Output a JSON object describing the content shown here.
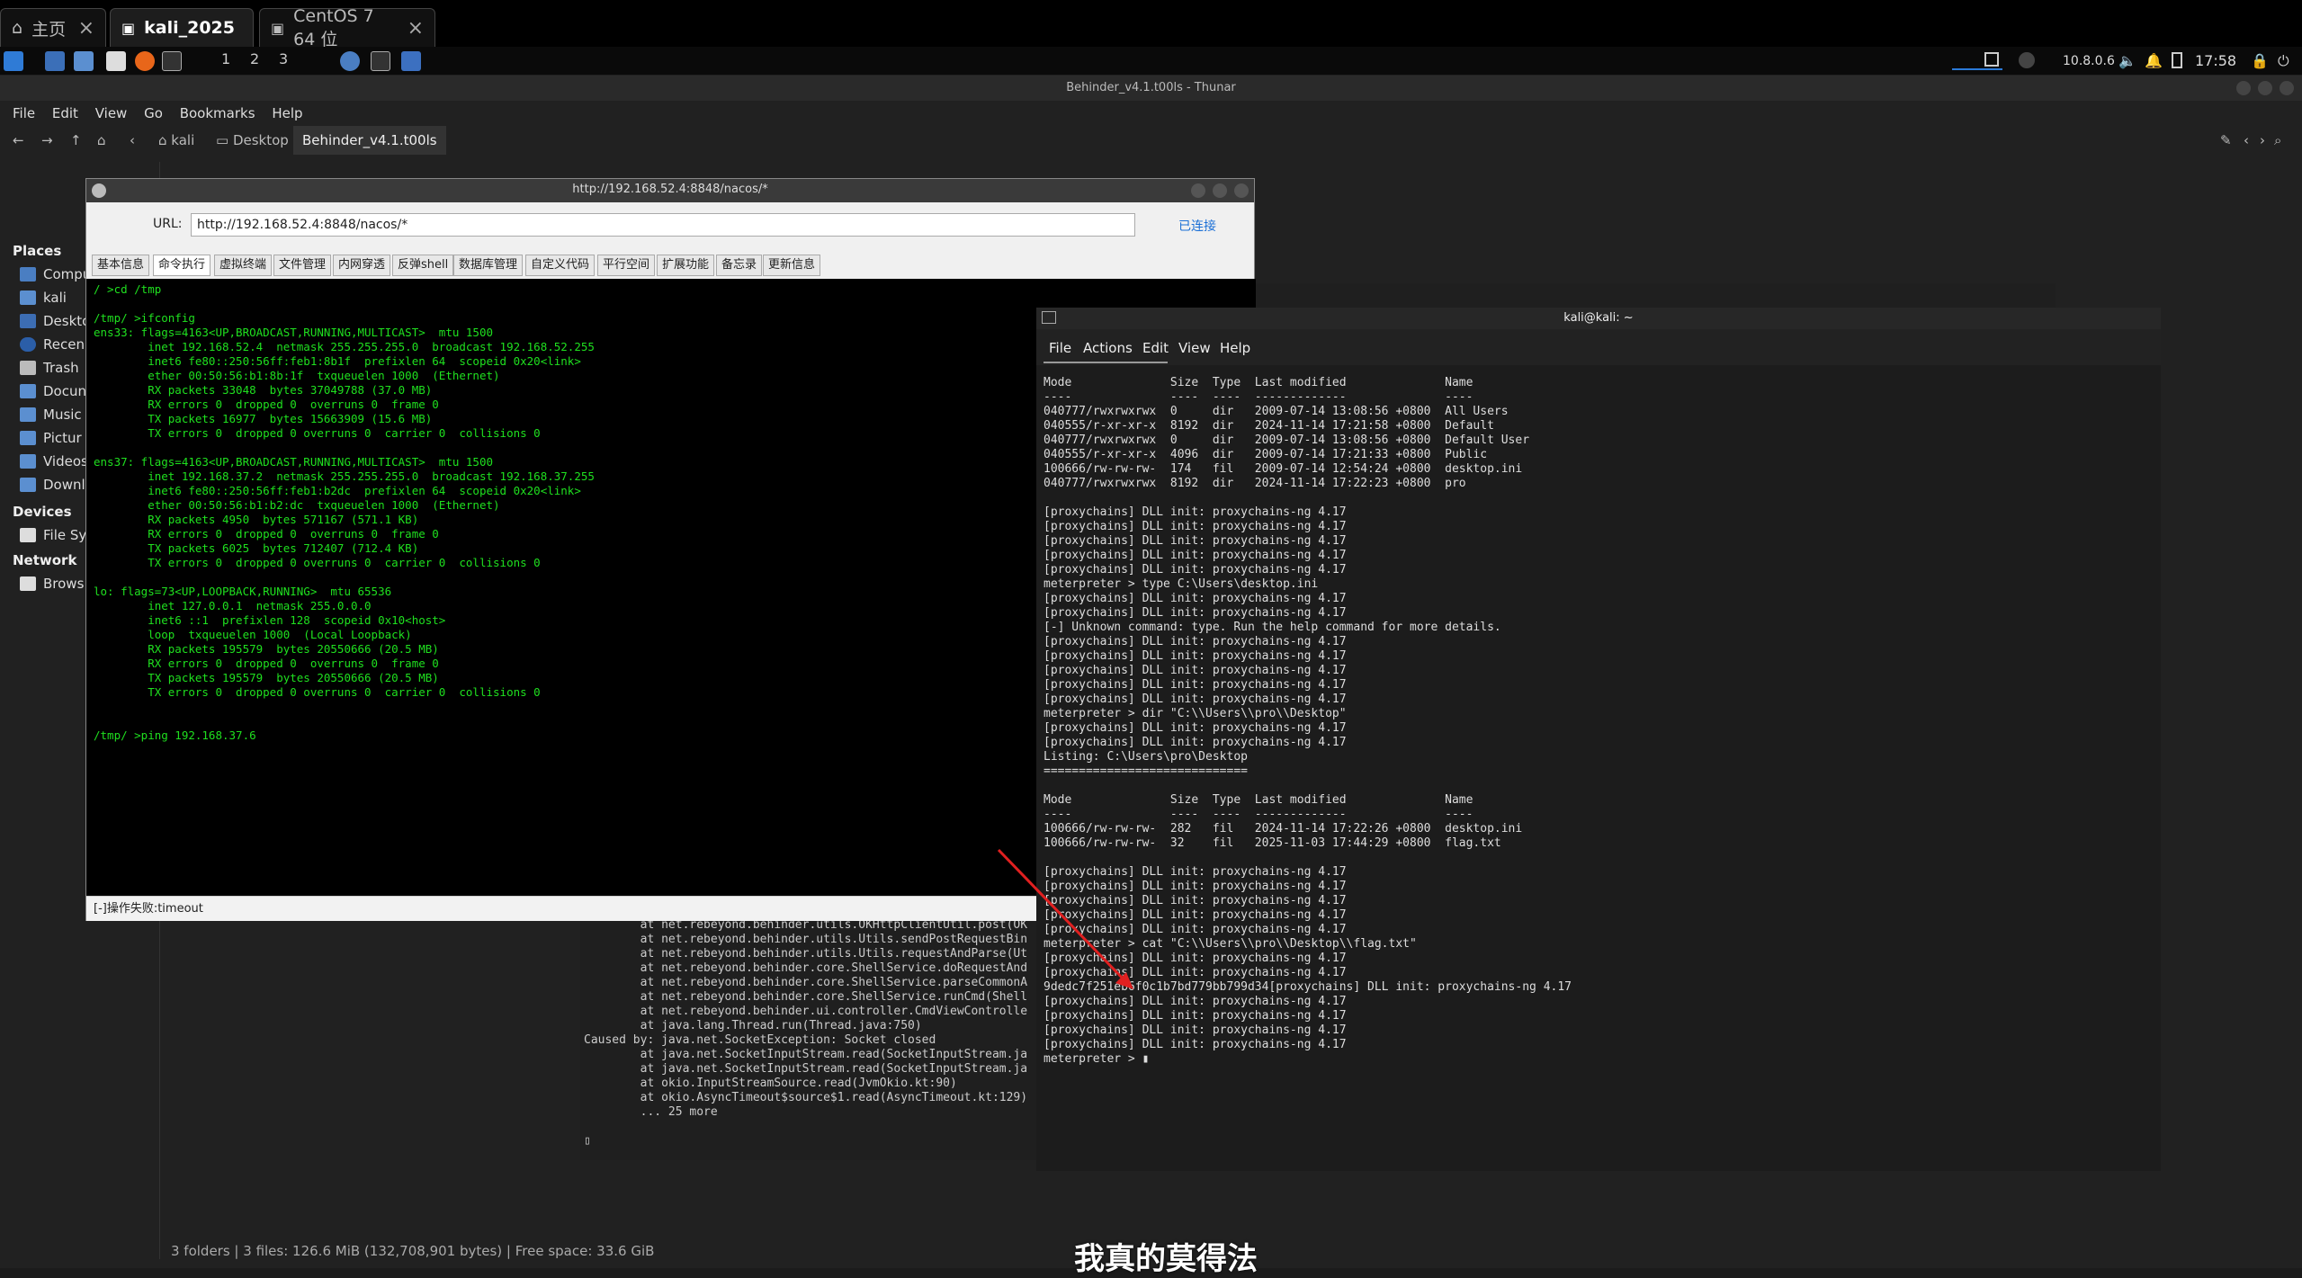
{
  "host_tabs": [
    {
      "label": "主页",
      "active": false
    },
    {
      "label": "kali_2025",
      "active": true
    },
    {
      "label": "CentOS 7 64 位",
      "active": false
    }
  ],
  "panel": {
    "workspaces": [
      "1",
      "2",
      "3"
    ],
    "ip": "10.8.0.6",
    "time": "17:58"
  },
  "thunar": {
    "title": "Behinder_v4.1.t00ls - Thunar",
    "menu": [
      "File",
      "Edit",
      "View",
      "Go",
      "Bookmarks",
      "Help"
    ],
    "breadcrumbs": [
      "kali",
      "Desktop",
      "Behinder_v4.1.t00ls"
    ],
    "sidebar": {
      "places_header": "Places",
      "places": [
        "Compu",
        "kali",
        "Deskto",
        "Recen",
        "Trash",
        "Docun",
        "Music",
        "Pictur",
        "Videos",
        "Downl"
      ],
      "devices_header": "Devices",
      "devices": [
        "File Sy"
      ],
      "network_header": "Network",
      "network": [
        "Brows"
      ]
    },
    "status": "3 folders  |  3 files: 126.6 MiB (132,708,901 bytes)  |  Free space: 33.6 GiB"
  },
  "behinder": {
    "title": "http://192.168.52.4:8848/nacos/*",
    "url_label": "URL:",
    "url": "http://192.168.52.4:8848/nacos/*",
    "connected": "已连接",
    "tabs": [
      "基本信息",
      "命令执行",
      "虚拟终端",
      "文件管理",
      "内网穿透",
      "反弹shell",
      "数据库管理",
      "自定义代码",
      "平行空间",
      "扩展功能",
      "备忘录",
      "更新信息"
    ],
    "console": "/ >cd /tmp\n\n/tmp/ >ifconfig\nens33: flags=4163<UP,BROADCAST,RUNNING,MULTICAST>  mtu 1500\n        inet 192.168.52.4  netmask 255.255.255.0  broadcast 192.168.52.255\n        inet6 fe80::250:56ff:feb1:8b1f  prefixlen 64  scopeid 0x20<link>\n        ether 00:50:56:b1:8b:1f  txqueuelen 1000  (Ethernet)\n        RX packets 33048  bytes 37049788 (37.0 MB)\n        RX errors 0  dropped 0  overruns 0  frame 0\n        TX packets 16977  bytes 15663909 (15.6 MB)\n        TX errors 0  dropped 0 overruns 0  carrier 0  collisions 0\n\nens37: flags=4163<UP,BROADCAST,RUNNING,MULTICAST>  mtu 1500\n        inet 192.168.37.2  netmask 255.255.255.0  broadcast 192.168.37.255\n        inet6 fe80::250:56ff:feb1:b2dc  prefixlen 64  scopeid 0x20<link>\n        ether 00:50:56:b1:b2:dc  txqueuelen 1000  (Ethernet)\n        RX packets 4950  bytes 571167 (571.1 KB)\n        RX errors 0  dropped 0  overruns 0  frame 0\n        TX packets 6025  bytes 712407 (712.4 KB)\n        TX errors 0  dropped 0 overruns 0  carrier 0  collisions 0\n\nlo: flags=73<UP,LOOPBACK,RUNNING>  mtu 65536\n        inet 127.0.0.1  netmask 255.0.0.0\n        inet6 ::1  prefixlen 128  scopeid 0x10<host>\n        loop  txqueuelen 1000  (Local Loopback)\n        RX packets 195579  bytes 20550666 (20.5 MB)\n        RX errors 0  dropped 0  overruns 0  frame 0\n        TX packets 195579  bytes 20550666 (20.5 MB)\n        TX errors 0  dropped 0 overruns 0  carrier 0  collisions 0\n\n\n/tmp/ >ping 192.168.37.6",
    "status": "[-]操作失败:timeout"
  },
  "bg_terminal": {
    "lines": "        at net.rebeyond.behinder.utils.OKHttpClientUtil.post(OK\n        at net.rebeyond.behinder.utils.Utils.sendPostRequestBin\n        at net.rebeyond.behinder.utils.Utils.requestAndParse(Ut\n        at net.rebeyond.behinder.core.ShellService.doRequestAnd\n        at net.rebeyond.behinder.core.ShellService.parseCommonA\n        at net.rebeyond.behinder.core.ShellService.runCmd(Shell\n        at net.rebeyond.behinder.ui.controller.CmdViewControlle\n        at java.lang.Thread.run(Thread.java:750)\nCaused by: java.net.SocketException: Socket closed\n        at java.net.SocketInputStream.read(SocketInputStream.ja\n        at java.net.SocketInputStream.read(SocketInputStream.ja\n        at okio.InputStreamSource.read(JvmOkio.kt:90)\n        at okio.AsyncTimeout$source$1.read(AsyncTimeout.kt:129)\n        ... 25 more\n\n▯"
  },
  "qterminal": {
    "title": "kali@kali: ~",
    "menu": [
      "File",
      "Actions",
      "Edit",
      "View",
      "Help"
    ],
    "output": "Mode              Size  Type  Last modified              Name\n----              ----  ----  -------------              ----\n040777/rwxrwxrwx  0     dir   2009-07-14 13:08:56 +0800  All Users\n040555/r-xr-xr-x  8192  dir   2024-11-14 17:21:58 +0800  Default\n040777/rwxrwxrwx  0     dir   2009-07-14 13:08:56 +0800  Default User\n040555/r-xr-xr-x  4096  dir   2009-07-14 17:21:33 +0800  Public\n100666/rw-rw-rw-  174   fil   2009-07-14 12:54:24 +0800  desktop.ini\n040777/rwxrwxrwx  8192  dir   2024-11-14 17:22:23 +0800  pro\n\n[proxychains] DLL init: proxychains-ng 4.17\n[proxychains] DLL init: proxychains-ng 4.17\n[proxychains] DLL init: proxychains-ng 4.17\n[proxychains] DLL init: proxychains-ng 4.17\n[proxychains] DLL init: proxychains-ng 4.17\nmeterpreter > type C:\\Users\\desktop.ini\n[proxychains] DLL init: proxychains-ng 4.17\n[proxychains] DLL init: proxychains-ng 4.17\n[-] Unknown command: type. Run the help command for more details.\n[proxychains] DLL init: proxychains-ng 4.17\n[proxychains] DLL init: proxychains-ng 4.17\n[proxychains] DLL init: proxychains-ng 4.17\n[proxychains] DLL init: proxychains-ng 4.17\n[proxychains] DLL init: proxychains-ng 4.17\nmeterpreter > dir \"C:\\\\Users\\\\pro\\\\Desktop\"\n[proxychains] DLL init: proxychains-ng 4.17\n[proxychains] DLL init: proxychains-ng 4.17\nListing: C:\\Users\\pro\\Desktop\n=============================\n\nMode              Size  Type  Last modified              Name\n----              ----  ----  -------------              ----\n100666/rw-rw-rw-  282   fil   2024-11-14 17:22:26 +0800  desktop.ini\n100666/rw-rw-rw-  32    fil   2025-11-03 17:44:29 +0800  flag.txt\n\n[proxychains] DLL init: proxychains-ng 4.17\n[proxychains] DLL init: proxychains-ng 4.17\n[proxychains] DLL init: proxychains-ng 4.17\n[proxychains] DLL init: proxychains-ng 4.17\n[proxychains] DLL init: proxychains-ng 4.17\nmeterpreter > cat \"C:\\\\Users\\\\pro\\\\Desktop\\\\flag.txt\"\n[proxychains] DLL init: proxychains-ng 4.17\n[proxychains] DLL init: proxychains-ng 4.17\n9dedc7f251eb6f0c1b7bd779bb799d34[proxychains] DLL init: proxychains-ng 4.17\n[proxychains] DLL init: proxychains-ng 4.17\n[proxychains] DLL init: proxychains-ng 4.17\n[proxychains] DLL init: proxychains-ng 4.17\n[proxychains] DLL init: proxychains-ng 4.17\nmeterpreter > ▮"
  },
  "subtitle": "我真的莫得法",
  "colors": {
    "console_green": "#1fe01f",
    "annotation_red": "#e02020",
    "link_blue": "#1a6fd6"
  }
}
